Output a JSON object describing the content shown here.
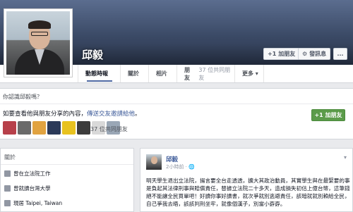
{
  "profile": {
    "name": "邱毅"
  },
  "cover_actions": {
    "add_friend": "加朋友",
    "add_friend_icon": "+1",
    "message": "發訊息",
    "message_icon": "gear-icon",
    "more": "..."
  },
  "tabs": [
    {
      "label": "動態時報"
    },
    {
      "label": "關於"
    },
    {
      "label": "相片"
    },
    {
      "label": "朋友",
      "count": "37 位共同朋友"
    },
    {
      "label": "更多 ▾"
    }
  ],
  "know": {
    "question": "你認識邱毅嗎？",
    "prompt_prefix": "如要查看他與朋友分享的內容，",
    "prompt_link": "傳送交友邀請給他",
    "prompt_suffix": "。",
    "add_friend": "+1 加朋友",
    "mutual": "37 位共同朋友",
    "friend_colors": [
      "#b7404a",
      "#6a6a6a",
      "#e1a341",
      "#2b3a59",
      "#e8c21f",
      "#3c3c3c",
      "#d9d9d9",
      "#9aa7b6"
    ]
  },
  "about": {
    "title": "關於",
    "items": [
      {
        "label": "曾在立法院工作"
      },
      {
        "label": "曾就讀台灣大學"
      },
      {
        "label": "現居 Taipei, Taiwan"
      }
    ]
  },
  "post": {
    "author": "邱毅",
    "time": "2小時前 · 🌐",
    "body": "明天學生退出立法院，揚言要全台走透透，擴大其政治動員，其實學生與在最緊要的事是負起其法律刑事與賠償責任，替據立法院二十多天，造成損失初估上億台幣，這筆錢絕不能讓全民買單吧！好讀你事好讀書，就次爭就別逃避責任，該暗就就別賴給全民，自己爭我去晤，該該判刑坐牢，就像個漢子，別當小孬孬。"
  }
}
